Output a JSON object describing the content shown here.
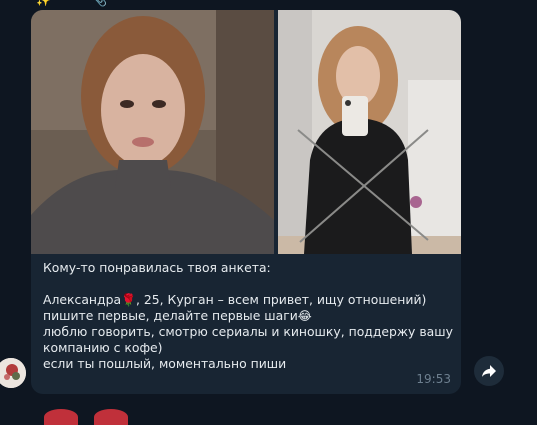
{
  "top_icons": [
    {
      "icon": "sparkles-icon",
      "glyph": "✨"
    },
    {
      "icon": "paperclip-icon",
      "glyph": "📎"
    }
  ],
  "message": {
    "photos": [
      {
        "icon": "photo-selfie"
      },
      {
        "icon": "photo-mirror-selfie"
      }
    ],
    "lines": [
      "Кому-то понравилась твоя анкета:",
      "",
      "Александра",
      ", 25, Курган – всем привет, ищу отношений)",
      "пишите первые, делайте первые шаги",
      "люблю говорить, смотрю сериалы и киношку, поддержу вашу",
      "компанию с кофе)",
      "если ты пошлый, моментально пиши"
    ],
    "rose_emoji": "🌹",
    "laugh_emoji": "😂",
    "time": "19:53"
  },
  "avatar": {
    "icon": "user-avatar"
  },
  "forward_button": {
    "icon": "share-arrow-icon"
  },
  "colors": {
    "background": "#0e1621",
    "bubble": "#182533",
    "text": "#e6ebef",
    "time": "#6d7f8f"
  }
}
